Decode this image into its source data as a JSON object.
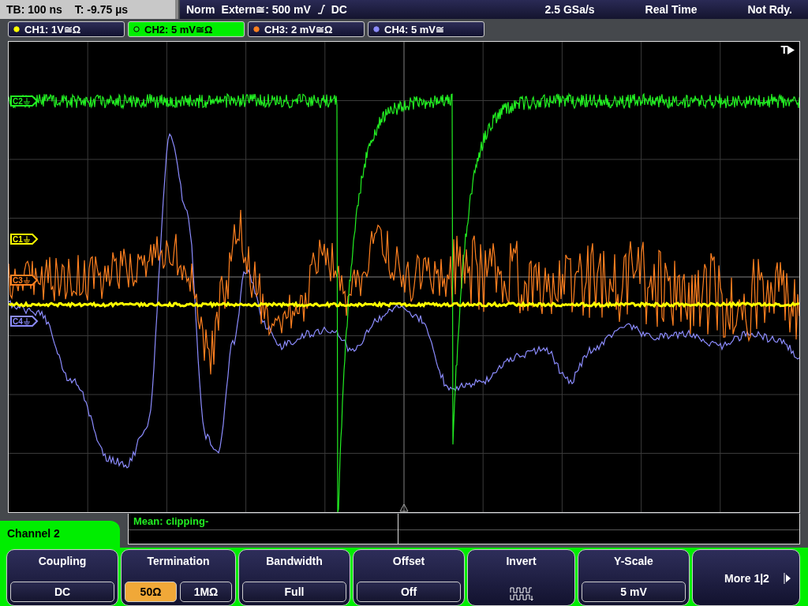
{
  "status_bar": {
    "timebase": "TB: 100 ns",
    "trigger_time": "T: -9.75 µs",
    "trigger_mode": "Norm",
    "trigger_source": "Extern≅: 500 mV",
    "trigger_coupling": "DC",
    "sample_rate": "2.5 GSa/s",
    "acquisition": "Real Time",
    "state": "Not Rdy."
  },
  "channels": [
    {
      "label": "CH1: 1V≅Ω",
      "color": "#ffff00",
      "selected": false
    },
    {
      "label": "CH2: 5 mV≅Ω",
      "color": "#22ee22",
      "selected": true
    },
    {
      "label": "CH3: 2 mV≅Ω",
      "color": "#ff8020",
      "selected": false
    },
    {
      "label": "CH4: 5 mV≅",
      "color": "#8c8cff",
      "selected": false
    }
  ],
  "plot": {
    "trigger_label": "T",
    "markers": [
      {
        "label": "C2",
        "color": "#22ee22"
      },
      {
        "label": "C1",
        "color": "#ffff00"
      },
      {
        "label": "C3",
        "color": "#ff8020"
      },
      {
        "label": "C4",
        "color": "#8c8cff"
      }
    ]
  },
  "measurement": {
    "text": "Mean: clipping-"
  },
  "menu": {
    "title": "Channel 2",
    "softkeys": [
      {
        "kind": "value",
        "label": "Coupling",
        "value": "DC"
      },
      {
        "kind": "options",
        "label": "Termination",
        "options": [
          {
            "label": "50Ω",
            "selected": true
          },
          {
            "label": "1MΩ",
            "selected": false
          }
        ]
      },
      {
        "kind": "value",
        "label": "Bandwidth",
        "value": "Full"
      },
      {
        "kind": "value",
        "label": "Offset",
        "value": "Off"
      },
      {
        "kind": "icon",
        "label": "Invert"
      },
      {
        "kind": "value",
        "label": "Y-Scale",
        "value": "5 mV"
      },
      {
        "kind": "more",
        "label": "More 1|2"
      }
    ]
  }
}
